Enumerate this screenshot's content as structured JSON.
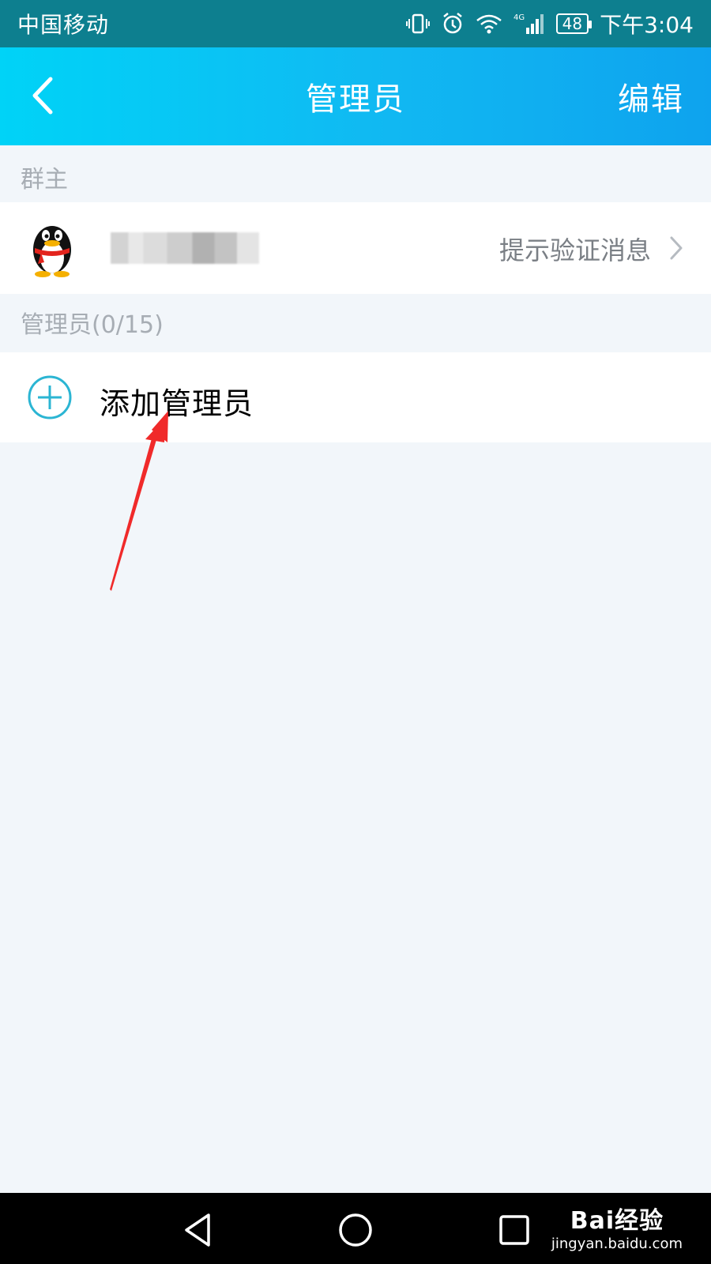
{
  "status_bar": {
    "carrier": "中国移动",
    "network": "4G",
    "battery": "48",
    "time": "下午3:04",
    "icons": [
      "vibrate-icon",
      "alarm-icon",
      "wifi-icon",
      "signal-icon",
      "battery-icon"
    ]
  },
  "header": {
    "title": "管理员",
    "edit_label": "编辑",
    "back_icon": "chevron-left-icon"
  },
  "owner_section": {
    "label": "群主",
    "owner": {
      "avatar": "qq-penguin-avatar",
      "hint": "提示验证消息",
      "chevron_icon": "chevron-right-icon"
    }
  },
  "admin_section": {
    "label": "管理员(0/15)",
    "add_label": "添加管理员",
    "add_icon": "plus-circle-icon"
  },
  "colors": {
    "header_gradient_start": "#00d3f7",
    "header_gradient_end": "#0ea3ee",
    "background": "#f2f6fa",
    "accent": "#2bb5d3",
    "annotation_arrow": "#f02a2a"
  },
  "nav_bar": {
    "icons": [
      "back-triangle-icon",
      "home-circle-icon",
      "recents-square-icon"
    ]
  },
  "watermark": {
    "brand": "Bai经验",
    "url": "jingyan.baidu.com"
  }
}
